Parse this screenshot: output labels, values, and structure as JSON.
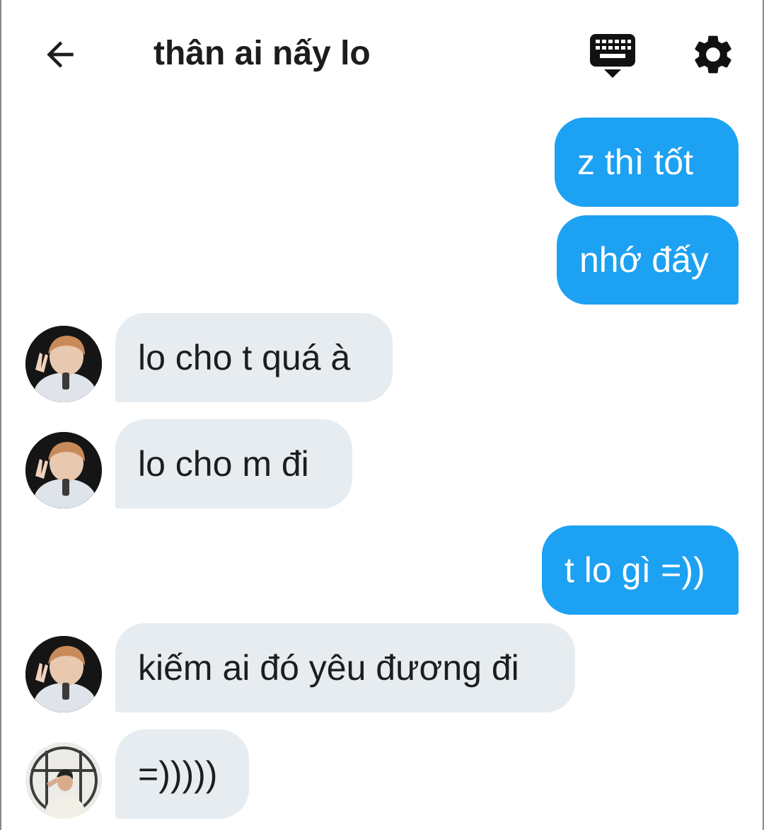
{
  "header": {
    "title": "thân ai nấy lo",
    "icons": {
      "back": "arrow-left-icon",
      "keyboard": "keyboard-hide-icon",
      "settings": "gear-icon"
    }
  },
  "colors": {
    "outgoing_bubble": "#1da1f2",
    "incoming_bubble": "#e6ecf0",
    "text_dark": "#1d1d1d"
  },
  "messages": [
    {
      "direction": "out",
      "text": "z thì tốt"
    },
    {
      "direction": "out",
      "text": "nhớ đấy"
    },
    {
      "direction": "in",
      "text": "lo cho t quá à"
    },
    {
      "direction": "in",
      "text": "lo cho m đi"
    },
    {
      "direction": "out",
      "text": "t lo gì =))"
    },
    {
      "direction": "in",
      "text": "kiếm ai đó yêu đương đi"
    },
    {
      "direction": "in",
      "text": "=)))))"
    }
  ]
}
